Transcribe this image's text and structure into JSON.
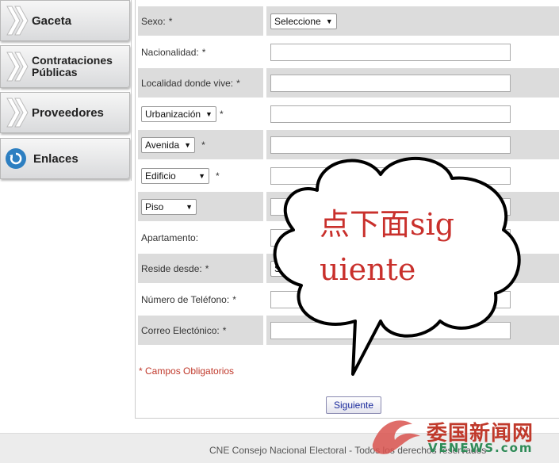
{
  "sidebar": {
    "items": [
      {
        "label": "Gaceta"
      },
      {
        "label": "Contrataciones Públicas"
      },
      {
        "label": "Proveedores"
      },
      {
        "label": "Enlaces"
      }
    ]
  },
  "form": {
    "sexo": {
      "label": "Sexo:",
      "required": "*",
      "select_value": "Seleccione"
    },
    "nacionalidad": {
      "label": "Nacionalidad:",
      "required": "*",
      "value": ""
    },
    "localidad": {
      "label": "Localidad donde vive:",
      "required": "*",
      "value": ""
    },
    "urbanizacion": {
      "select_value": "Urbanización",
      "required": "*",
      "value": ""
    },
    "avenida": {
      "select_value": "Avenida",
      "required": "*",
      "value": ""
    },
    "edificio": {
      "select_value": "Edificio",
      "required": "*",
      "value": ""
    },
    "piso": {
      "select_value": "Piso",
      "value": ""
    },
    "apartamento": {
      "label": "Apartamento:",
      "value": ""
    },
    "reside": {
      "label": "Reside desde:",
      "required": "*",
      "select_value": "Sel"
    },
    "telefono": {
      "label": "Número de Teléfono:",
      "required": "*",
      "value": ""
    },
    "correo": {
      "label": "Correo Electónico:",
      "required": "*",
      "value": ""
    },
    "obligatorios": "* Campos Obligatorios",
    "submit_label": "Siguiente"
  },
  "footer": {
    "text": "CNE Consejo Nacional Electoral - Todos los derechos reservados"
  },
  "overlay": {
    "line1": "点下面sig",
    "line2": "uiente"
  },
  "watermark": {
    "cn": "委国新闻网",
    "en": "VENEWS.com"
  }
}
